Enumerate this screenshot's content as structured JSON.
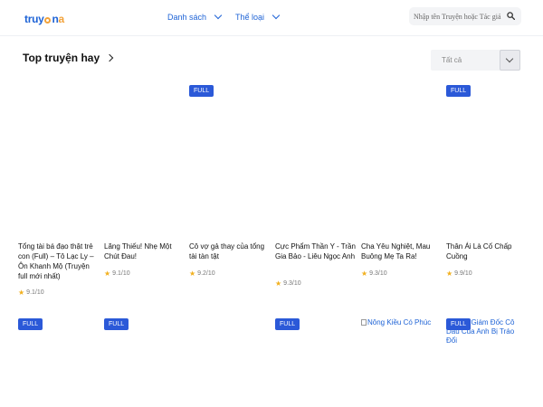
{
  "header": {
    "logo_prefix": "truy",
    "logo_suffix": "n",
    "logo_tail": "a",
    "nav": [
      {
        "label": "Danh sách"
      },
      {
        "label": "Thể loại"
      }
    ],
    "search_placeholder": "Nhập tên Truyện hoặc Tác giả"
  },
  "section": {
    "title": "Top truyện hay",
    "filter_value": "Tất cả"
  },
  "row1": [
    {
      "title": "Tổng tài bá đạo thật trẻ con (Full) – Tô Lạc Ly – Ôn Khanh Mộ (Truyện full mới nhất)",
      "rating": "9.1/10",
      "badge": ""
    },
    {
      "title": "Lăng Thiếu! Nhẹ Một Chút Đau!",
      "rating": "9.1/10",
      "badge": ""
    },
    {
      "title": "Cô vợ gả thay của tổng tài tàn tật",
      "rating": "9.2/10",
      "badge": "FULL"
    },
    {
      "title": "Cực Phẩm Thần Y - Trần Gia Bảo - Liêu Ngọc Anh",
      "rating": "9.3/10",
      "badge": ""
    },
    {
      "title": "Cha Yêu Nghiệt, Mau Buông Mẹ Ta Ra!",
      "rating": "9.3/10",
      "badge": ""
    },
    {
      "title": "Thân Ái Là Cố Chấp Cuồng",
      "rating": "9.9/10",
      "badge": "FULL"
    }
  ],
  "row2": {
    "badge": "FULL",
    "broken_alt_1": "Nông Kiều Có Phúc",
    "broken_alt_2": "Tổng Giám Đốc Cô Dâu Của Anh Bị Tráo Đổi"
  },
  "colors": {
    "accent": "#1e63d6",
    "badge": "#2b59d8",
    "star": "#f2b01e",
    "logo_accent": "#f2a23a"
  }
}
